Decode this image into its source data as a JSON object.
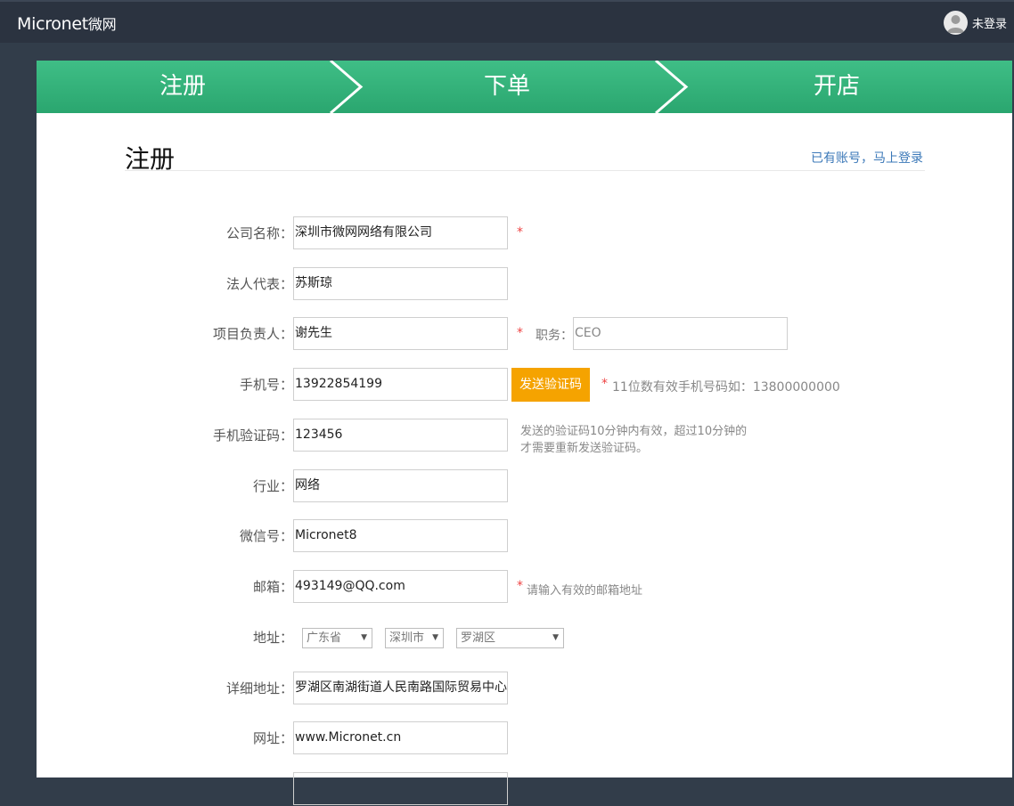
{
  "header": {
    "brand": "Micronet",
    "brand_cn": "微网",
    "user_status": "未登录"
  },
  "steps": [
    "注册",
    "下单",
    "开店"
  ],
  "page": {
    "title": "注册",
    "login_link": "已有账号，马上登录"
  },
  "form": {
    "company": {
      "label": "公司名称：",
      "value": "深圳市微网网络有限公司",
      "required": "*"
    },
    "legal": {
      "label": "法人代表：",
      "value": "苏斯琼"
    },
    "manager": {
      "label": "项目负责人：",
      "value": "谢先生",
      "required": "*",
      "position_label": "职务：",
      "position_value": "CEO"
    },
    "phone": {
      "label": "手机号：",
      "value": "13922854199",
      "button": "发送验证码",
      "required": "*",
      "hint": "11位数有效手机号码如：13800000000"
    },
    "code": {
      "label": "手机验证码：",
      "value": "123456",
      "hint_line1": "发送的验证码10分钟内有效，超过10分钟的",
      "hint_line2": "才需要重新发送验证码。"
    },
    "industry": {
      "label": "行业：",
      "value": "网络"
    },
    "wechat": {
      "label": "微信号：",
      "value": "Micronet8"
    },
    "email": {
      "label": "邮箱：",
      "value": "493149@QQ.com",
      "required": "*",
      "hint": "请输入有效的邮箱地址"
    },
    "address": {
      "label": "地址：",
      "province": "广东省",
      "city": "深圳市",
      "district": "罗湖区"
    },
    "detail_address": {
      "label": "详细地址：",
      "value": "罗湖区南湖街道人民南路国际贸易中心大厦"
    },
    "website": {
      "label": "网址：",
      "value": "www.Micronet.cn"
    }
  }
}
